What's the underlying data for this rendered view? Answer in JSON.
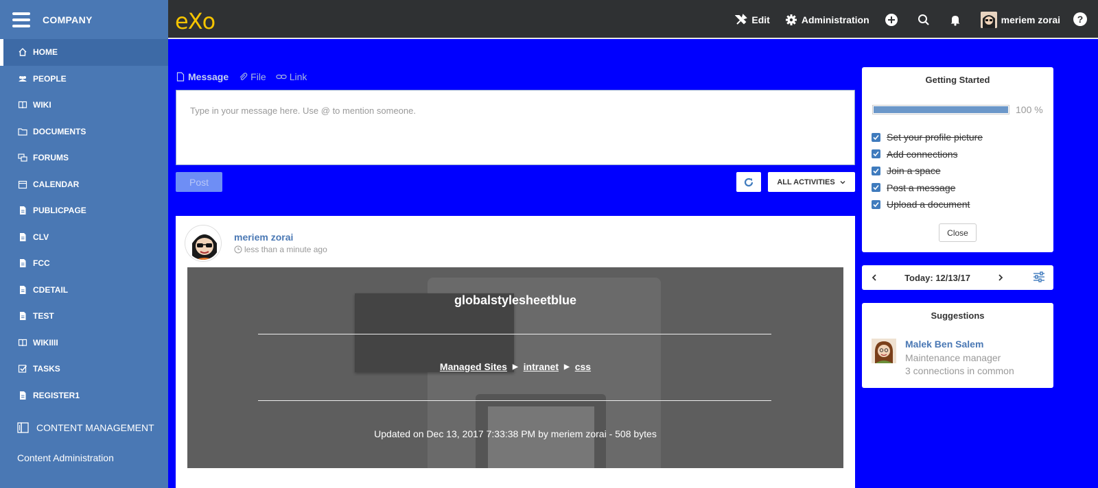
{
  "sidebar": {
    "company": "COMPANY",
    "items": [
      {
        "label": "HOME",
        "icon": "home-icon"
      },
      {
        "label": "PEOPLE",
        "icon": "people-icon"
      },
      {
        "label": "WIKI",
        "icon": "book-icon"
      },
      {
        "label": "DOCUMENTS",
        "icon": "folder-icon"
      },
      {
        "label": "FORUMS",
        "icon": "forums-icon"
      },
      {
        "label": "CALENDAR",
        "icon": "calendar-icon"
      },
      {
        "label": "PUBLICPAGE",
        "icon": "page-icon"
      },
      {
        "label": "CLV",
        "icon": "page-icon"
      },
      {
        "label": "FCC",
        "icon": "page-icon"
      },
      {
        "label": "CDETAIL",
        "icon": "page-icon"
      },
      {
        "label": "TEST",
        "icon": "page-icon"
      },
      {
        "label": "WIKIIII",
        "icon": "book-icon"
      },
      {
        "label": "TASKS",
        "icon": "tasks-icon"
      },
      {
        "label": "REGISTER1",
        "icon": "page-icon"
      }
    ],
    "content_management": "CONTENT MANAGEMENT",
    "content_administration": "Content Administration"
  },
  "topbar": {
    "logo": "eXo",
    "edit": "Edit",
    "administration": "Administration",
    "user": "meriem zorai",
    "help": "?"
  },
  "composer": {
    "tabs": [
      "Message",
      "File",
      "Link"
    ],
    "placeholder": "Type in your message here. Use @ to mention someone.",
    "post": "Post",
    "filter": "ALL ACTIVITIES"
  },
  "activity": {
    "user": "meriem zorai",
    "time": "less than a minute ago",
    "doc_title": "globalstylesheetblue",
    "path": [
      "Managed Sites",
      "intranet",
      "css"
    ],
    "updated": "Updated on Dec 13, 2017 7:33:38 PM by meriem zorai - 508 bytes"
  },
  "getting_started": {
    "title": "Getting Started",
    "progress_percent": 100,
    "progress_label": "100 %",
    "tasks": [
      "Set your profile picture",
      "Add connections",
      "Join a space",
      "Post a message",
      "Upload a document"
    ],
    "close": "Close"
  },
  "calendar": {
    "title": "Today: 12/13/17"
  },
  "suggestions": {
    "title": "Suggestions",
    "name": "Malek Ben Salem",
    "role": "Maintenance manager",
    "common": "3 connections in common"
  },
  "colors": {
    "sidebar": "#4a78b4",
    "topbar": "#2f3133",
    "page_bg": "#0000ff",
    "link": "#4a78b4",
    "logo": "#f5c400"
  }
}
